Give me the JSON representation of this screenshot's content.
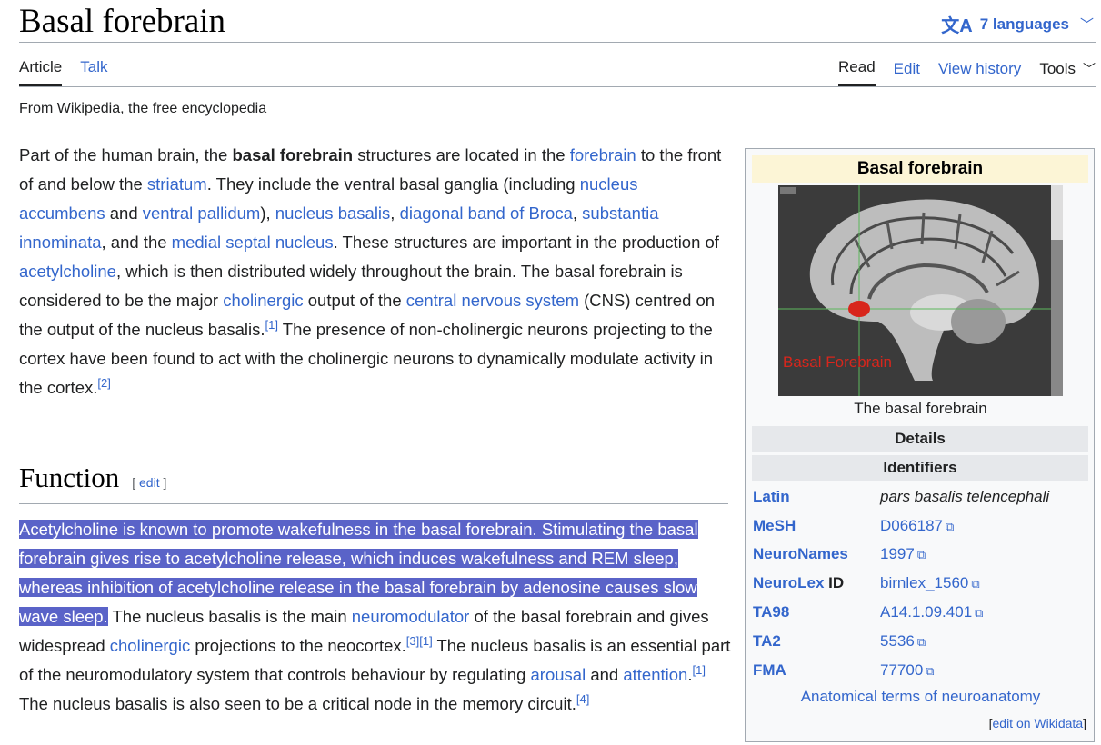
{
  "page": {
    "title": "Basal forebrain",
    "tagline": "From Wikipedia, the free encyclopedia"
  },
  "header": {
    "languages_label": "7 languages",
    "languages_icon": "translate-icon"
  },
  "tabs": {
    "left": [
      "Article",
      "Talk"
    ],
    "right": [
      "Read",
      "Edit",
      "View history",
      "Tools"
    ]
  },
  "intro": {
    "t1": "Part of the human brain, the ",
    "bold": "basal forebrain",
    "t2": " structures are located in the ",
    "l_forebrain": "forebrain",
    "t3": " to the front of and below the ",
    "l_striatum": "striatum",
    "t4": ". They include the ventral basal ganglia (including ",
    "l_nacc": "nucleus accumbens",
    "t5": " and ",
    "l_vp": "ventral pallidum",
    "t6": "), ",
    "l_nb": "nucleus basalis",
    "t7": ", ",
    "l_dbb": "diagonal band of Broca",
    "t8": ", ",
    "l_si": "substantia innominata",
    "t9": ", and the ",
    "l_msn": "medial septal nucleus",
    "t10": ". These structures are important in the production of ",
    "l_ach": "acetylcholine",
    "t11": ", which is then distributed widely throughout the brain. The basal forebrain is considered to be the major ",
    "l_chol": "cholinergic",
    "t12": " output of the ",
    "l_cns": "central nervous system",
    "t13": " (CNS) centred on the output of the nucleus basalis.",
    "ref1": "[1]",
    "t14": " The presence of non-cholinergic neurons projecting to the cortex have been found to act with the cholinergic neurons to dynamically modulate activity in the cortex.",
    "ref2": "[2]"
  },
  "function_section": {
    "heading": "Function",
    "edit_open": "[ ",
    "edit_label": "edit",
    "edit_close": " ]",
    "highlighted": "Acetylcholine is known to promote wakefulness in the basal forebrain. Stimulating the basal forebrain gives rise to acetylcholine release, which induces wakefulness and REM sleep, whereas inhibition of acetylcholine release in the basal forebrain by adenosine causes slow wave sleep.",
    "t1": " The nucleus basalis is the main ",
    "l_nm": "neuromodulator",
    "t2": " of the basal forebrain and gives widespread ",
    "l_chol": "cholinergic",
    "t3": " projections to the neocortex.",
    "ref3": "[3]",
    "ref1a": "[1]",
    "t4": " The nucleus basalis is an essential part of the neuromodulatory system that controls behaviour by regulating ",
    "l_arousal": "arousal",
    "t5": " and ",
    "l_attention": "attention",
    "ref1b": "[1]",
    "t6": " The nucleus basalis is also seen to be a critical node in the memory circuit.",
    "ref4": "[4]",
    "dot": "."
  },
  "infobox": {
    "title": "Basal forebrain",
    "image_label": "Basal Forebrain",
    "caption": "The basal forebrain",
    "details": "Details",
    "identifiers": "Identifiers",
    "rows": [
      {
        "key": "Latin",
        "value": "pars basalis telencephali"
      },
      {
        "key": "MeSH",
        "value": "D066187"
      },
      {
        "key": "NeuroNames",
        "value": "1997"
      },
      {
        "key": "NeuroLex",
        "key_suffix": " ID",
        "value": "birnlex_1560"
      },
      {
        "key": "TA98",
        "value": "A14.1.09.401"
      },
      {
        "key": "TA2",
        "value": "5536"
      },
      {
        "key": "FMA",
        "value": "77700"
      }
    ],
    "external_icon": "external-link-icon",
    "footer_link": "Anatomical terms of neuroanatomy",
    "wikidata_open": "[",
    "wikidata_label": "edit on Wikidata",
    "wikidata_close": "]"
  },
  "colors": {
    "link": "#3366cc",
    "highlight": "#5a63c8",
    "title_band": "#fcf5d6",
    "brain_marker": "#d8261c"
  }
}
